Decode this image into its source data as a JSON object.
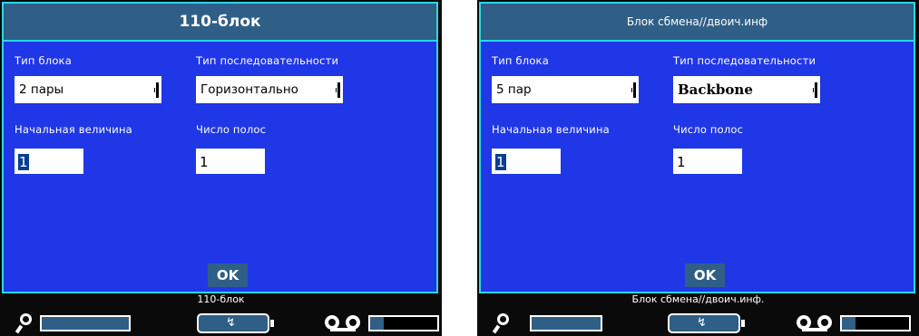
{
  "screens": [
    {
      "title": "110-блок",
      "label_block_type": "Тип блока",
      "label_sequence_type": "Тип последовательности",
      "block_type_value": "2 пары",
      "sequence_type_value": "Горизонтально",
      "label_start_value": "Начальная величина",
      "label_field_count": "Число полос",
      "start_value": "1",
      "field_count_value": "1",
      "ok_label": "OK",
      "status_text": "110-блок",
      "tape_fill_fraction": 0.2
    },
    {
      "title": "Блок сбмена//двоич.инф",
      "label_block_type": "Тип блока",
      "label_sequence_type": "Тип последовательности",
      "block_type_value": "5 пар",
      "sequence_type_value": "Backbone",
      "label_start_value": "Начальная величина",
      "label_field_count": "Число полос",
      "start_value": "1",
      "field_count_value": "1",
      "ok_label": "OK",
      "status_text": "Блок сбмена//двоич.инф.",
      "tape_fill_fraction": 0.2
    }
  ],
  "colors": {
    "title_bg": "#2f5f86",
    "panel_bg": "#1f37e6",
    "border": "#2ad8e6",
    "selection": "#0a3d91"
  },
  "icons": [
    "search-icon",
    "battery-icon",
    "tape-icon"
  ]
}
